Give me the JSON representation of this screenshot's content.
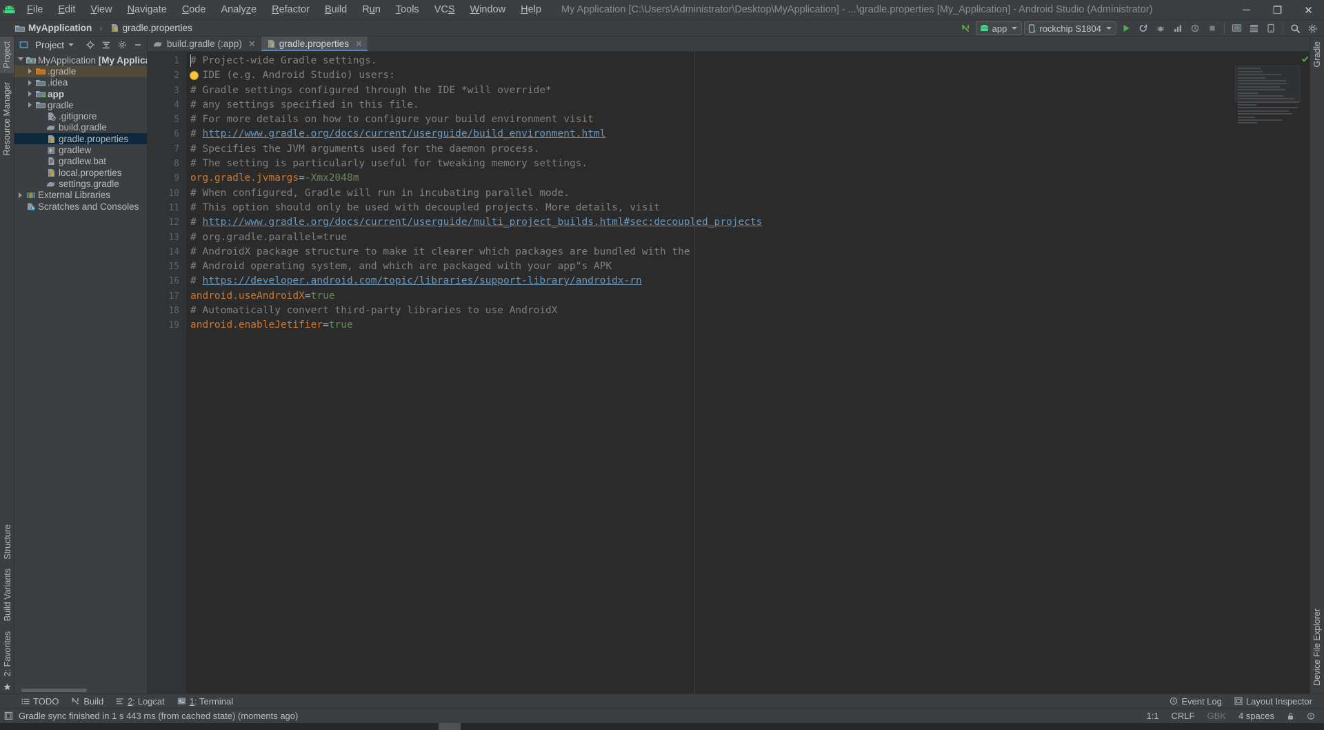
{
  "window": {
    "title": "My Application [C:\\Users\\Administrator\\Desktop\\MyApplication] - ...\\gradle.properties [My_Application] - Android Studio (Administrator)",
    "minimize": "─",
    "maximize": "❐",
    "close": "✕",
    "logo_icon": "android-logo-icon"
  },
  "menubar": {
    "items": [
      {
        "label": "File",
        "mnemonic": "F"
      },
      {
        "label": "Edit",
        "mnemonic": "E"
      },
      {
        "label": "View",
        "mnemonic": "V"
      },
      {
        "label": "Navigate",
        "mnemonic": "N"
      },
      {
        "label": "Code",
        "mnemonic": "C"
      },
      {
        "label": "Analyze",
        "mnemonic": "z"
      },
      {
        "label": "Refactor",
        "mnemonic": "R"
      },
      {
        "label": "Build",
        "mnemonic": "B"
      },
      {
        "label": "Run",
        "mnemonic": "u"
      },
      {
        "label": "Tools",
        "mnemonic": "T"
      },
      {
        "label": "VCS",
        "mnemonic": "S"
      },
      {
        "label": "Window",
        "mnemonic": "W"
      },
      {
        "label": "Help",
        "mnemonic": "H"
      }
    ]
  },
  "breadcrumb": {
    "project": "MyApplication",
    "separator": "›",
    "file": "gradle.properties"
  },
  "toolbar": {
    "run_config": "app",
    "device": "rockchip S1804",
    "icons": [
      "make-project-icon",
      "run-icon",
      "debug-icon",
      "profile-icon",
      "attach-debugger-icon",
      "stop-icon",
      "avd-manager-icon",
      "sdk-manager-icon",
      "search-everywhere-icon",
      "settings-icon"
    ]
  },
  "left_strip": {
    "tabs": [
      {
        "label": "Project",
        "icon": "project-icon",
        "active": true
      },
      {
        "label": "Resource Manager",
        "icon": "resource-manager-icon",
        "active": false
      }
    ],
    "bottom_tabs": [
      {
        "label": "Structure",
        "icon": "structure-icon"
      },
      {
        "label": "Build Variants",
        "icon": "build-variants-icon"
      },
      {
        "label": "2: Favorites",
        "icon": "favorites-icon"
      }
    ]
  },
  "right_strip": {
    "tabs": [
      {
        "label": "Gradle",
        "icon": "gradle-icon"
      },
      {
        "label": "Device File Explorer",
        "icon": "device-file-explorer-icon"
      }
    ]
  },
  "project_panel": {
    "title": "Project",
    "dropdown_icon": "chevron-down-icon",
    "actions": [
      "locate-icon",
      "collapse-all-icon",
      "settings-icon",
      "hide-icon"
    ],
    "tree": [
      {
        "label": "MyApplication",
        "suffix": "[My Application]",
        "indent": 0,
        "arrow": "open",
        "icon": "module-icon",
        "bold_suffix": true,
        "state": "normal"
      },
      {
        "label": ".gradle",
        "indent": 1,
        "arrow": "closed",
        "icon": "folder-orange-icon",
        "state": "highlight"
      },
      {
        "label": ".idea",
        "indent": 1,
        "arrow": "closed",
        "icon": "folder-icon",
        "state": "normal"
      },
      {
        "label": "app",
        "indent": 1,
        "arrow": "closed",
        "icon": "folder-module-icon",
        "bold": true,
        "state": "normal"
      },
      {
        "label": "gradle",
        "indent": 1,
        "arrow": "closed",
        "icon": "folder-icon",
        "state": "normal"
      },
      {
        "label": ".gitignore",
        "indent": 2,
        "arrow": "none",
        "icon": "gitignore-icon",
        "state": "normal"
      },
      {
        "label": "build.gradle",
        "indent": 2,
        "arrow": "none",
        "icon": "gradle-file-icon",
        "state": "normal"
      },
      {
        "label": "gradle.properties",
        "indent": 2,
        "arrow": "none",
        "icon": "properties-file-icon",
        "state": "selected"
      },
      {
        "label": "gradlew",
        "indent": 2,
        "arrow": "none",
        "icon": "script-icon",
        "state": "normal"
      },
      {
        "label": "gradlew.bat",
        "indent": 2,
        "arrow": "none",
        "icon": "bat-file-icon",
        "state": "normal"
      },
      {
        "label": "local.properties",
        "indent": 2,
        "arrow": "none",
        "icon": "properties-file-icon",
        "state": "normal"
      },
      {
        "label": "settings.gradle",
        "indent": 2,
        "arrow": "none",
        "icon": "gradle-file-icon",
        "state": "normal"
      },
      {
        "label": "External Libraries",
        "indent": 0,
        "arrow": "closed",
        "icon": "libraries-icon",
        "state": "normal"
      },
      {
        "label": "Scratches and Consoles",
        "indent": 0,
        "arrow": "none",
        "icon": "scratches-icon",
        "state": "normal"
      }
    ]
  },
  "editor_tabs": [
    {
      "label": "build.gradle (:app)",
      "icon": "gradle-file-icon",
      "active": false,
      "close": "✕"
    },
    {
      "label": "gradle.properties",
      "icon": "properties-file-icon",
      "active": true,
      "close": "✕"
    }
  ],
  "editor": {
    "filename": "gradle.properties",
    "line_count": 19,
    "lines": [
      {
        "n": 1,
        "tokens": [
          {
            "t": "# Project-wide Gradle settings.",
            "c": "comment"
          }
        ]
      },
      {
        "n": 2,
        "tokens": [
          {
            "t": "# IDE (e.g. Android Studio) users:",
            "c": "comment"
          }
        ],
        "bulb": true
      },
      {
        "n": 3,
        "tokens": [
          {
            "t": "# Gradle settings configured through the IDE *will override*",
            "c": "comment"
          }
        ]
      },
      {
        "n": 4,
        "tokens": [
          {
            "t": "# any settings specified in this file.",
            "c": "comment"
          }
        ]
      },
      {
        "n": 5,
        "tokens": [
          {
            "t": "# For more details on how to configure your build environment visit",
            "c": "comment"
          }
        ]
      },
      {
        "n": 6,
        "tokens": [
          {
            "t": "# ",
            "c": "comment"
          },
          {
            "t": "http://www.gradle.org/docs/current/userguide/build_environment.html",
            "c": "link"
          }
        ]
      },
      {
        "n": 7,
        "tokens": [
          {
            "t": "# Specifies the JVM arguments used for the daemon process.",
            "c": "comment"
          }
        ]
      },
      {
        "n": 8,
        "tokens": [
          {
            "t": "# The setting is particularly useful for tweaking memory settings.",
            "c": "comment"
          }
        ]
      },
      {
        "n": 9,
        "tokens": [
          {
            "t": "org.gradle.jvmargs",
            "c": "key"
          },
          {
            "t": "=",
            "c": "eq"
          },
          {
            "t": "-Xmx2048m",
            "c": "val"
          }
        ]
      },
      {
        "n": 10,
        "tokens": [
          {
            "t": "# When configured, Gradle will run in incubating parallel mode.",
            "c": "comment"
          }
        ]
      },
      {
        "n": 11,
        "tokens": [
          {
            "t": "# This option should only be used with decoupled projects. More details, visit",
            "c": "comment"
          }
        ]
      },
      {
        "n": 12,
        "tokens": [
          {
            "t": "# ",
            "c": "comment"
          },
          {
            "t": "http://www.gradle.org/docs/current/userguide/multi_project_builds.html#sec:decoupled_projects",
            "c": "link"
          }
        ]
      },
      {
        "n": 13,
        "tokens": [
          {
            "t": "# org.gradle.parallel=true",
            "c": "comment"
          }
        ]
      },
      {
        "n": 14,
        "tokens": [
          {
            "t": "# AndroidX package structure to make it clearer which packages are bundled with the",
            "c": "comment"
          }
        ]
      },
      {
        "n": 15,
        "tokens": [
          {
            "t": "# Android operating system, and which are packaged with your app\"s APK",
            "c": "comment"
          }
        ]
      },
      {
        "n": 16,
        "tokens": [
          {
            "t": "# ",
            "c": "comment"
          },
          {
            "t": "https://developer.android.com/topic/libraries/support-library/androidx-rn",
            "c": "link"
          }
        ]
      },
      {
        "n": 17,
        "tokens": [
          {
            "t": "android.useAndroidX",
            "c": "key"
          },
          {
            "t": "=",
            "c": "eq"
          },
          {
            "t": "true",
            "c": "val"
          }
        ]
      },
      {
        "n": 18,
        "tokens": [
          {
            "t": "# Automatically convert third-party libraries to use AndroidX",
            "c": "comment"
          }
        ]
      },
      {
        "n": 19,
        "tokens": [
          {
            "t": "android.enableJetifier",
            "c": "key"
          },
          {
            "t": "=",
            "c": "eq"
          },
          {
            "t": "true",
            "c": "val"
          }
        ]
      }
    ],
    "inspection_status": "ok-check-icon"
  },
  "tool_windows": [
    {
      "label": "TODO",
      "icon": "todo-icon",
      "mnemonic": ""
    },
    {
      "label": "Build",
      "icon": "build-icon",
      "mnemonic": ""
    },
    {
      "label": "2: Logcat",
      "icon": "logcat-icon",
      "mnemonic": "2"
    },
    {
      "label": "1: Terminal",
      "icon": "terminal-icon",
      "mnemonic": "1"
    }
  ],
  "tool_windows_right": [
    {
      "label": "Event Log",
      "icon": "event-log-icon"
    },
    {
      "label": "Layout Inspector",
      "icon": "layout-inspector-icon"
    }
  ],
  "statusbar": {
    "icon": "console-icon",
    "message": "Gradle sync finished in 1 s 443 ms (from cached state) (moments ago)",
    "caret_position": "1:1",
    "line_separator": "CRLF",
    "encoding": "GBK",
    "indent": "4 spaces",
    "lock_icon": "unlock-icon",
    "inspection_icon": "inspection-icon"
  },
  "colors": {
    "chrome": "#3c3f41",
    "editor_bg": "#2b2b2b",
    "gutter_bg": "#313335",
    "selection_blue": "#0d293e",
    "tab_active": "#4e5254",
    "tab_underline": "#4a88c7",
    "comment": "#808080",
    "key_orange": "#cc7832",
    "value_green": "#6a8759",
    "link_blue": "#6897bb",
    "accent_green": "#62b543"
  }
}
